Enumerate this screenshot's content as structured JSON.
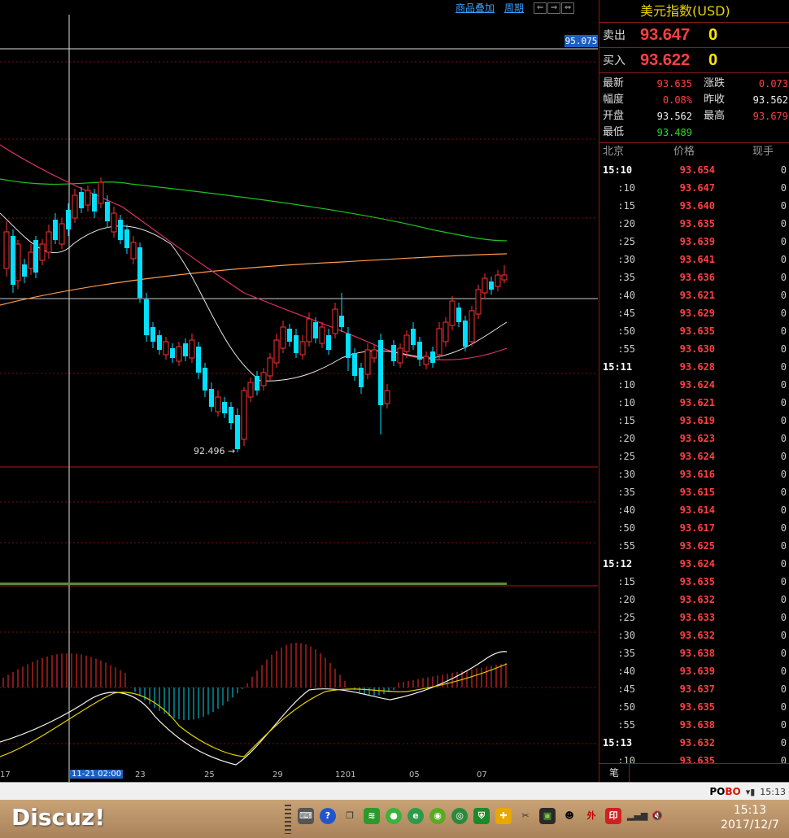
{
  "toolbar": {
    "overlay_label": "商品叠加",
    "period_label": "周期"
  },
  "chart": {
    "price_tag": "95.075",
    "min_label": "92.496 →",
    "x_labels": [
      "17",
      "11-21 02:00",
      "23",
      "25",
      "29",
      "1201",
      "05",
      "07"
    ],
    "cursor_label": "11-21 02:00"
  },
  "quote": {
    "title": "美元指数(USD)",
    "ask_label": "卖出",
    "ask_price": "93.647",
    "ask_vol": "0",
    "bid_label": "买入",
    "bid_price": "93.622",
    "bid_vol": "0",
    "latest_label": "最新",
    "latest": "93.635",
    "change_label": "涨跌",
    "change": "0.073",
    "amp_label": "幅度",
    "amp": "0.08%",
    "prev_label": "昨收",
    "prev": "93.562",
    "open_label": "开盘",
    "open": "93.562",
    "high_label": "最高",
    "high": "93.679",
    "low_label": "最低",
    "low": "93.489"
  },
  "ticks": {
    "headers": [
      "北京",
      "价格",
      "现手"
    ],
    "rows": [
      {
        "t": "15:10",
        "p": "93.654",
        "q": "0",
        "major": true
      },
      {
        "t": ":10",
        "p": "93.647",
        "q": "0"
      },
      {
        "t": ":15",
        "p": "93.640",
        "q": "0"
      },
      {
        "t": ":20",
        "p": "93.635",
        "q": "0"
      },
      {
        "t": ":25",
        "p": "93.639",
        "q": "0"
      },
      {
        "t": ":30",
        "p": "93.641",
        "q": "0"
      },
      {
        "t": ":35",
        "p": "93.636",
        "q": "0"
      },
      {
        "t": ":40",
        "p": "93.621",
        "q": "0"
      },
      {
        "t": ":45",
        "p": "93.629",
        "q": "0"
      },
      {
        "t": ":50",
        "p": "93.635",
        "q": "0"
      },
      {
        "t": ":55",
        "p": "93.630",
        "q": "0"
      },
      {
        "t": "15:11",
        "p": "93.628",
        "q": "0",
        "major": true
      },
      {
        "t": ":10",
        "p": "93.624",
        "q": "0"
      },
      {
        "t": ":10",
        "p": "93.621",
        "q": "0"
      },
      {
        "t": ":15",
        "p": "93.619",
        "q": "0"
      },
      {
        "t": ":20",
        "p": "93.623",
        "q": "0"
      },
      {
        "t": ":25",
        "p": "93.624",
        "q": "0"
      },
      {
        "t": ":30",
        "p": "93.616",
        "q": "0"
      },
      {
        "t": ":35",
        "p": "93.615",
        "q": "0"
      },
      {
        "t": ":40",
        "p": "93.614",
        "q": "0"
      },
      {
        "t": ":50",
        "p": "93.617",
        "q": "0"
      },
      {
        "t": ":55",
        "p": "93.625",
        "q": "0"
      },
      {
        "t": "15:12",
        "p": "93.624",
        "q": "0",
        "major": true
      },
      {
        "t": ":15",
        "p": "93.635",
        "q": "0"
      },
      {
        "t": ":20",
        "p": "93.632",
        "q": "0"
      },
      {
        "t": ":25",
        "p": "93.633",
        "q": "0"
      },
      {
        "t": ":30",
        "p": "93.632",
        "q": "0"
      },
      {
        "t": ":35",
        "p": "93.638",
        "q": "0"
      },
      {
        "t": ":40",
        "p": "93.639",
        "q": "0"
      },
      {
        "t": ":45",
        "p": "93.637",
        "q": "0"
      },
      {
        "t": ":50",
        "p": "93.635",
        "q": "0"
      },
      {
        "t": ":55",
        "p": "93.638",
        "q": "0"
      },
      {
        "t": "15:13",
        "p": "93.632",
        "q": "0",
        "major": true
      },
      {
        "t": ":10",
        "p": "93.635",
        "q": "0"
      }
    ],
    "tab_label": "笔"
  },
  "status": {
    "brand_a": "PO",
    "brand_b": "BO",
    "time": "15:13"
  },
  "taskbar": {
    "logo": "Discuz!",
    "clock_time": "15:13",
    "clock_date": "2017/12/7"
  }
}
